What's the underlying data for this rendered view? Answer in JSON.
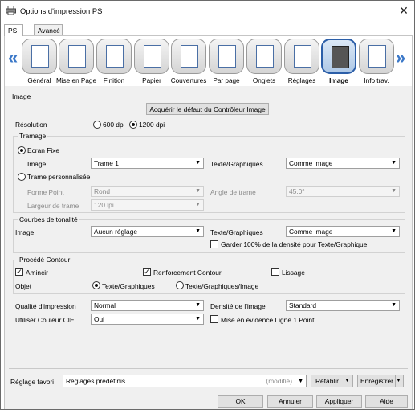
{
  "window": {
    "title": "Options d'impression PS",
    "close": "✕"
  },
  "tabs": [
    "PS",
    "Avancé"
  ],
  "iconbar": {
    "items": [
      {
        "label": "Général"
      },
      {
        "label": "Mise en Page"
      },
      {
        "label": "Finition"
      },
      {
        "label": "Papier"
      },
      {
        "label": "Couvertures"
      },
      {
        "label": "Par page"
      },
      {
        "label": "Onglets"
      },
      {
        "label": "Réglages"
      },
      {
        "label": "Image",
        "selected": true
      },
      {
        "label": "Info trav."
      }
    ],
    "prev": "«",
    "next": "»"
  },
  "image": {
    "section": "Image",
    "acquire_btn": "Acquérir le défaut du Contrôleur Image",
    "resolution": {
      "label": "Résolution",
      "opt1": "600 dpi",
      "opt2": "1200 dpi",
      "selected": "1200 dpi"
    }
  },
  "tramage": {
    "title": "Tramage",
    "ecran_fixe": "Ecran Fixe",
    "image_label": "Image",
    "image_value": "Trame 1",
    "texte_label": "Texte/Graphiques",
    "texte_value": "Comme image",
    "trame_perso": "Trame personnalisée",
    "forme_label": "Forme Point",
    "forme_value": "Rond",
    "angle_label": "Angle de trame",
    "angle_value": "45.0°",
    "largeur_label": "Largeur de trame",
    "largeur_value": "120 lpi"
  },
  "courbes": {
    "title": "Courbes de tonalité",
    "image_label": "Image",
    "image_value": "Aucun réglage",
    "texte_label": "Texte/Graphiques",
    "texte_value": "Comme image",
    "garder": "Garder 100% de la densité pour Texte/Graphique"
  },
  "contour": {
    "title": "Procédé Contour",
    "amincir": "Amincir",
    "renforcement": "Renforcement Contour",
    "lissage": "Lissage",
    "objet_label": "Objet",
    "objet_opt1": "Texte/Graphiques",
    "objet_opt2": "Texte/Graphiques/Image"
  },
  "qualite": {
    "label": "Qualité d'impression",
    "value": "Normal",
    "densite_label": "Densité de l'image",
    "densite_value": "Standard"
  },
  "couleur": {
    "label": "Utiliser Couleur CIE",
    "value": "Oui",
    "evidence": "Mise en évidence Ligne 1 Point"
  },
  "favori": {
    "label": "Réglage favori",
    "value": "Réglages prédéfinis",
    "modified": "(modifié)",
    "retablir": "Rétablir",
    "enregistrer": "Enregistrer"
  },
  "buttons": {
    "ok": "OK",
    "cancel": "Annuler",
    "apply": "Appliquer",
    "help": "Aide"
  }
}
